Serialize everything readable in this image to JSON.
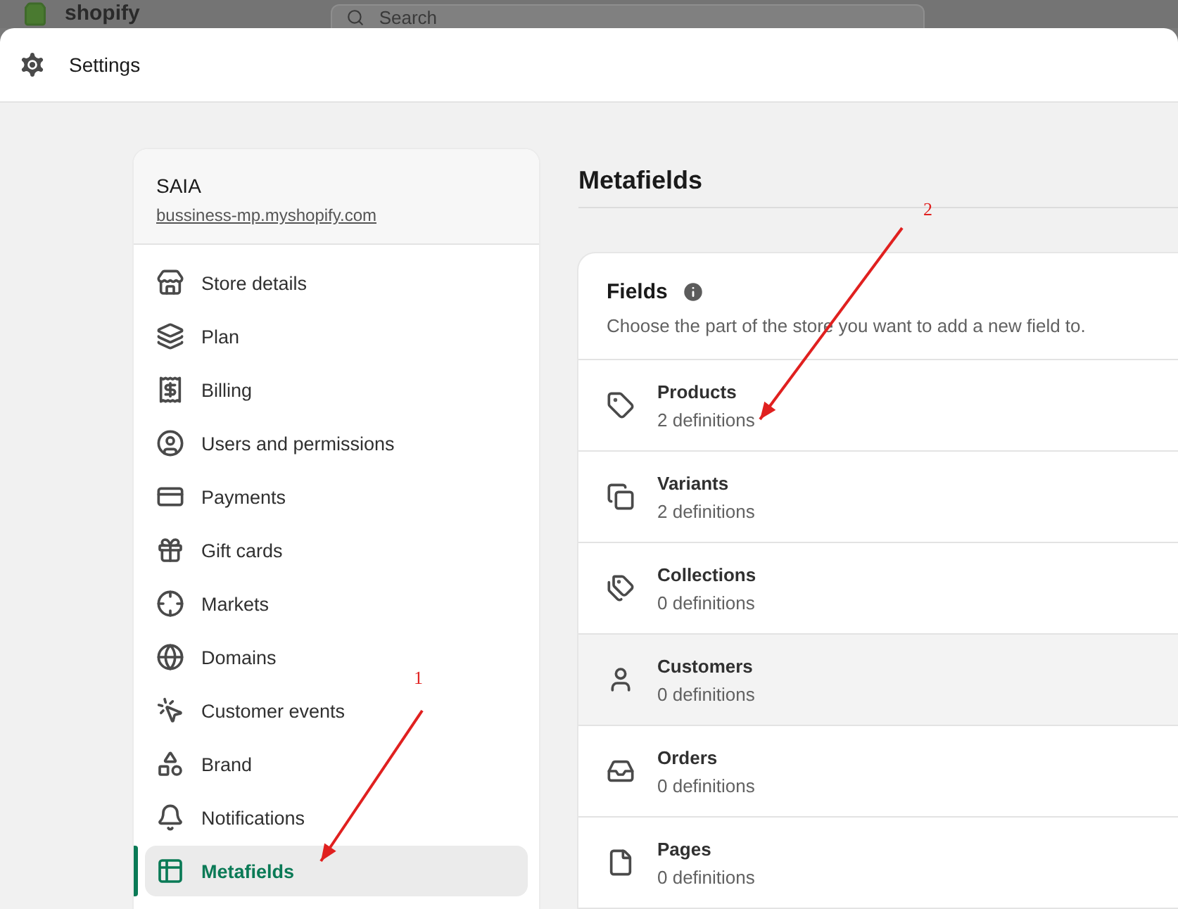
{
  "top_bar": {
    "logo": "shopify",
    "search": {
      "placeholder": "Search"
    }
  },
  "window": {
    "title": "Settings"
  },
  "store": {
    "name": "SAIA",
    "domain": "bussiness-mp.myshopify.com"
  },
  "sidebar": {
    "items": [
      {
        "label": "Store details",
        "selected": false
      },
      {
        "label": "Plan",
        "selected": false
      },
      {
        "label": "Billing",
        "selected": false
      },
      {
        "label": "Users and permissions",
        "selected": false
      },
      {
        "label": "Payments",
        "selected": false
      },
      {
        "label": "Gift cards",
        "selected": false
      },
      {
        "label": "Markets",
        "selected": false
      },
      {
        "label": "Domains",
        "selected": false
      },
      {
        "label": "Customer events",
        "selected": false
      },
      {
        "label": "Brand",
        "selected": false
      },
      {
        "label": "Notifications",
        "selected": false
      },
      {
        "label": "Metafields",
        "selected": true
      }
    ]
  },
  "page_title": "Metafields",
  "fields_card": {
    "title": "Fields",
    "description": "Choose the part of the store you want to add a new field to.",
    "rows": [
      {
        "name": "Products",
        "count": "2 definitions",
        "highlighted": false
      },
      {
        "name": "Variants",
        "count": "2 definitions",
        "highlighted": false
      },
      {
        "name": "Collections",
        "count": "0 definitions",
        "highlighted": false
      },
      {
        "name": "Customers",
        "count": "0 definitions",
        "highlighted": true
      },
      {
        "name": "Orders",
        "count": "0 definitions",
        "highlighted": false
      },
      {
        "name": "Pages",
        "count": "0 definitions",
        "highlighted": false
      }
    ]
  },
  "annotations": [
    {
      "label": "1"
    },
    {
      "label": "2"
    }
  ]
}
